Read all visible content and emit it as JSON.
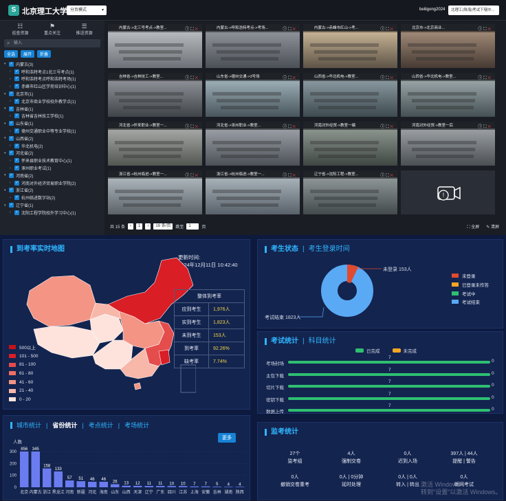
{
  "header": {
    "brand": "北京理工大学",
    "mode": "分页模式",
    "user": "beiligong2024",
    "school": "北理工(珠海)考试下辖中..."
  },
  "sidebar": {
    "tabs": [
      {
        "label": "巡查资源",
        "icon": "tree-icon"
      },
      {
        "label": "重点关注",
        "icon": "flag-icon"
      },
      {
        "label": "推送资源",
        "icon": "push-icon"
      }
    ],
    "search_placeholder": "输入",
    "buttons": [
      "全选",
      "展开",
      "折叠"
    ],
    "tree": [
      {
        "level": 0,
        "label": "内蒙古(3)"
      },
      {
        "level": 1,
        "label": "呼和浩特考点1北三号考点(1)"
      },
      {
        "level": 1,
        "label": "呼和浩特考点呼和浩特考场(1)"
      },
      {
        "level": 1,
        "label": "赤峰市红山区学苑培训中心(1)"
      },
      {
        "level": 0,
        "label": "北京市(1)"
      },
      {
        "level": 1,
        "label": "北京市商业学校校外教学点(1)"
      },
      {
        "level": 0,
        "label": "吉林省(1)"
      },
      {
        "level": 1,
        "label": "吉林省吉林技工学校(1)"
      },
      {
        "level": 0,
        "label": "山东省(1)"
      },
      {
        "level": 1,
        "label": "德州交通职业中等专业学校(1)"
      },
      {
        "level": 0,
        "label": "山西省(2)"
      },
      {
        "level": 1,
        "label": "华北机电(2)"
      },
      {
        "level": 0,
        "label": "河北省(2)"
      },
      {
        "level": 1,
        "label": "怀来县职业技术教育中心(1)"
      },
      {
        "level": 1,
        "label": "涿州职业考试(1)"
      },
      {
        "level": 0,
        "label": "河南省(2)"
      },
      {
        "level": 1,
        "label": "河南对外经济贸易职业学院(2)"
      },
      {
        "level": 0,
        "label": "浙江省(2)"
      },
      {
        "level": 1,
        "label": "杭州临进数字站(2)"
      },
      {
        "level": 0,
        "label": "辽宁省(1)"
      },
      {
        "level": 1,
        "label": "沈阳工程学院校外学习中心(1)"
      }
    ]
  },
  "cameras": [
    {
      "title": "内蒙古->北三号考点->教室..."
    },
    {
      "title": "内蒙古->呼和浩特考点->考场..."
    },
    {
      "title": "内蒙古->赤峰市红山->考..."
    },
    {
      "title": "北京市->北京商业..."
    },
    {
      "title": "吉林省->吉林技工->教室..."
    },
    {
      "title": "山东省->德州交通->3号场"
    },
    {
      "title": "山西省->华北机电->教室..."
    },
    {
      "title": "山西省->华北机电->教室..."
    },
    {
      "title": "河北省->怀来职业->教室一..."
    },
    {
      "title": "河北省->涿州职业->教室..."
    },
    {
      "title": "河南对外经贸->教室一编"
    },
    {
      "title": "河南对外经贸->教室一后"
    },
    {
      "title": "浙江省->杭州临进->教室一..."
    },
    {
      "title": "浙江省->杭州临进->教室一..."
    },
    {
      "title": "辽宁省->沈阳工程->教室..."
    }
  ],
  "pager": {
    "total": "共 15 条",
    "page": "1",
    "per_page": "16 条/页",
    "goto_label": "跳至",
    "goto_value": "1",
    "page_unit": "页",
    "fullscreen": "全屏",
    "clear": "清屏"
  },
  "map_panel": {
    "title": "到考率实时地图",
    "update_label": "更新时间:",
    "update_time": "2024年12月11日 10:42:40",
    "table_title": "整体到考率",
    "rows": [
      {
        "label": "应到考生",
        "value": "1,976人"
      },
      {
        "label": "实到考生",
        "value": "1,823人"
      },
      {
        "label": "未到考生",
        "value": "153人"
      },
      {
        "label": "到考率",
        "value": "92.26%"
      },
      {
        "label": "缺考率",
        "value": "7.74%"
      }
    ],
    "legend": [
      {
        "label": "500以上",
        "color": "#c4121a"
      },
      {
        "label": "101 - 500",
        "color": "#d91e26"
      },
      {
        "label": "81 - 100",
        "color": "#e54c4c"
      },
      {
        "label": "61 - 80",
        "color": "#ee6f63"
      },
      {
        "label": "41 - 60",
        "color": "#f39485"
      },
      {
        "label": "21 - 40",
        "color": "#f7b7a9"
      },
      {
        "label": "0 - 20",
        "color": "#fde3dc"
      }
    ]
  },
  "status_panel": {
    "title": "考生状态",
    "tab2": "考生登录时间",
    "callout_top": "未登录 153人",
    "callout_bottom": "考试结束 1823人",
    "legend": [
      {
        "label": "未登录",
        "color": "#e04a2f"
      },
      {
        "label": "已登录未作答",
        "color": "#f5a623"
      },
      {
        "label": "考试中",
        "color": "#2fbf71"
      },
      {
        "label": "考试结束",
        "color": "#5aa9f5"
      }
    ],
    "colors": {
      "not_logged": "#e04a2f",
      "finished": "#5aa9f5"
    }
  },
  "exam_panel": {
    "title": "考试统计",
    "tab2": "科目统计",
    "legend": [
      {
        "label": "已完成",
        "color": "#2fbf71"
      },
      {
        "label": "未完成",
        "color": "#f5a623"
      }
    ],
    "rows": [
      {
        "label": "考场封场",
        "done": "7",
        "undone": "0"
      },
      {
        "label": "主包下载",
        "done": "7",
        "undone": "0"
      },
      {
        "label": "切片下载",
        "done": "7",
        "undone": "0"
      },
      {
        "label": "密钥下载",
        "done": "7",
        "undone": "0"
      },
      {
        "label": "数据上传",
        "done": "7",
        "undone": "0"
      }
    ]
  },
  "city_panel": {
    "tabs": [
      "城市统计",
      "省份统计",
      "考点统计",
      "考场统计"
    ],
    "active_tab": "省份统计",
    "more": "更多",
    "color": "#6b7cf0"
  },
  "chart_data": {
    "type": "bar",
    "ylabel": "人数",
    "ylim": [
      0,
      300
    ],
    "yticks": [
      "300",
      "200",
      "100",
      "0"
    ],
    "categories": [
      "北京",
      "内蒙古",
      "浙江",
      "黑龙江",
      "河南",
      "新疆",
      "河北",
      "海南",
      "山东",
      "山西",
      "天津",
      "辽宁",
      "广东",
      "四川",
      "江苏",
      "上海",
      "安徽",
      "吉林",
      "湖南",
      "陕西"
    ],
    "values": [
      856,
      345,
      158,
      133,
      57,
      51,
      46,
      46,
      26,
      13,
      12,
      11,
      11,
      10,
      10,
      7,
      7,
      5,
      4,
      4
    ],
    "labels": [
      "856",
      "345",
      "158",
      "133",
      "57",
      "51",
      "46",
      "46",
      "26",
      "13",
      "12",
      "11",
      "11",
      "10",
      "10",
      "7",
      "7",
      "5",
      "4",
      "4"
    ]
  },
  "monitor_panel": {
    "title": "监考统计",
    "stats": [
      {
        "value": "27个",
        "label": "监考组"
      },
      {
        "value": "4人",
        "label": "强制交卷"
      },
      {
        "value": "0人",
        "label": "迟到入场"
      },
      {
        "value": "397人 | 44人",
        "label": "提醒 | 警告"
      },
      {
        "value": "0人",
        "label": "撤销交卷重考"
      },
      {
        "value": "0人 | 0分钟",
        "label": "延时处理"
      },
      {
        "value": "0人 | 0人",
        "label": "转入 | 转出"
      },
      {
        "value": "0人",
        "label": "断网考试"
      }
    ]
  },
  "watermark": {
    "line1": "激活 Windows",
    "line2": "转到\"设置\"以激活 Windows。"
  }
}
